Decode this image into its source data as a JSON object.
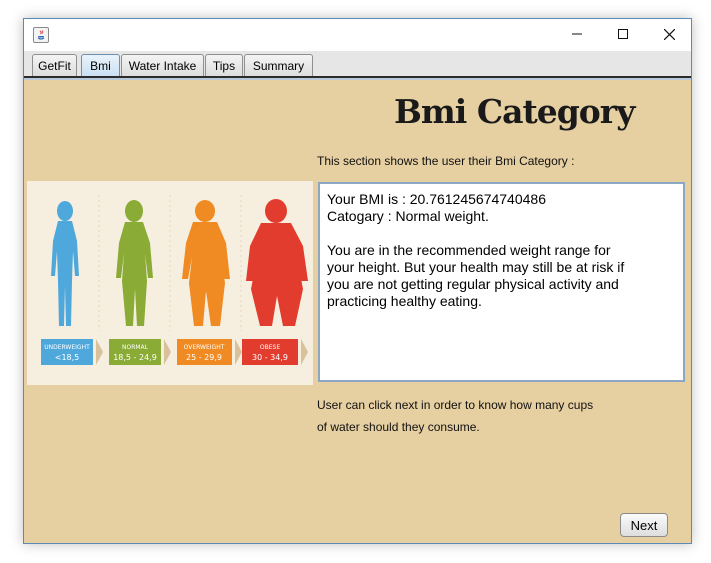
{
  "tabs": [
    {
      "label": "GetFit"
    },
    {
      "label": "Bmi",
      "active": true
    },
    {
      "label": "Water Intake"
    },
    {
      "label": "Tips"
    },
    {
      "label": "Summary"
    }
  ],
  "page": {
    "heading": "Bmi Category",
    "subtitle": "This section shows the user their Bmi Category :"
  },
  "result": {
    "bmi_line": "Your BMI is : 20.761245674740486",
    "category_line": "Catogary : Normal weight.",
    "advice_lines": [
      "You are in the recommended weight range for",
      "your height. But your health may still be at risk if",
      "you are not getting regular physical activity and",
      "practicing healthy eating."
    ]
  },
  "figure": {
    "categories": [
      {
        "label": "UNDERWEIGHT",
        "range": "<18,5",
        "color": "#4fa8dc"
      },
      {
        "label": "NORMAL",
        "range": "18,5 - 24,9",
        "color": "#8aab35"
      },
      {
        "label": "OVERWEIGHT",
        "range": "25 - 29,9",
        "color": "#f08a22"
      },
      {
        "label": "OBESE",
        "range": "30 - 34,9",
        "color": "#e23c2e"
      }
    ]
  },
  "footer": {
    "line1": "User can click next in order to know how many cups",
    "line2": "of water should they consume."
  },
  "buttons": {
    "next": "Next"
  },
  "colors": {
    "panel_bg": "#e6cfa1",
    "figure_bg": "#f6eedf",
    "arrow": "#d9c19a"
  }
}
